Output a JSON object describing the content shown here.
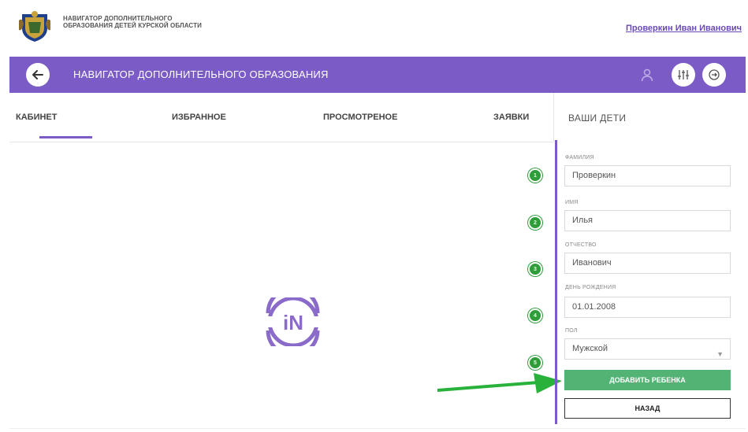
{
  "header": {
    "org_name": "НАВИГАТОР ДОПОЛНИТЕЛЬНОГО ОБРАЗОВАНИЯ ДЕТЕЙ КУРСКОЙ ОБЛАСТИ",
    "user_name": "Проверкин Иван Иванович"
  },
  "navbar": {
    "title": "НАВИГАТОР ДОПОЛНИТЕЛЬНОГО ОБРАЗОВАНИЯ",
    "icons": [
      "back-arrow-icon",
      "person-icon",
      "filter-sliders-icon",
      "logout-icon"
    ],
    "color": "#7b5cc6"
  },
  "tabs": [
    {
      "label": "КАБИНЕТ",
      "active": true
    },
    {
      "label": "ИЗБРАННОЕ",
      "active": false
    },
    {
      "label": "ПРОСМОТРЕНОЕ",
      "active": false
    },
    {
      "label": "ЗАЯВКИ",
      "active": false
    }
  ],
  "logo_text": "iN",
  "steps": [
    "1",
    "2",
    "3",
    "4",
    "5"
  ],
  "kids_panel": {
    "title": "ВАШИ ДЕТИ",
    "fields": [
      {
        "label": "ФАМИЛИЯ",
        "value": "Проверкин"
      },
      {
        "label": "ИМЯ",
        "value": "Илья"
      },
      {
        "label": "ОТЧЕСТВО",
        "value": "Иванович"
      },
      {
        "label": "ДЕНЬ РОЖДЕНИЯ",
        "value": "01.01.2008"
      },
      {
        "label": "ПОЛ",
        "value": "Мужской"
      }
    ],
    "add_button": "ДОБАВИТЬ РЕБЕНКА",
    "back_button": "НАЗАД",
    "accent_green": "#52b374"
  }
}
